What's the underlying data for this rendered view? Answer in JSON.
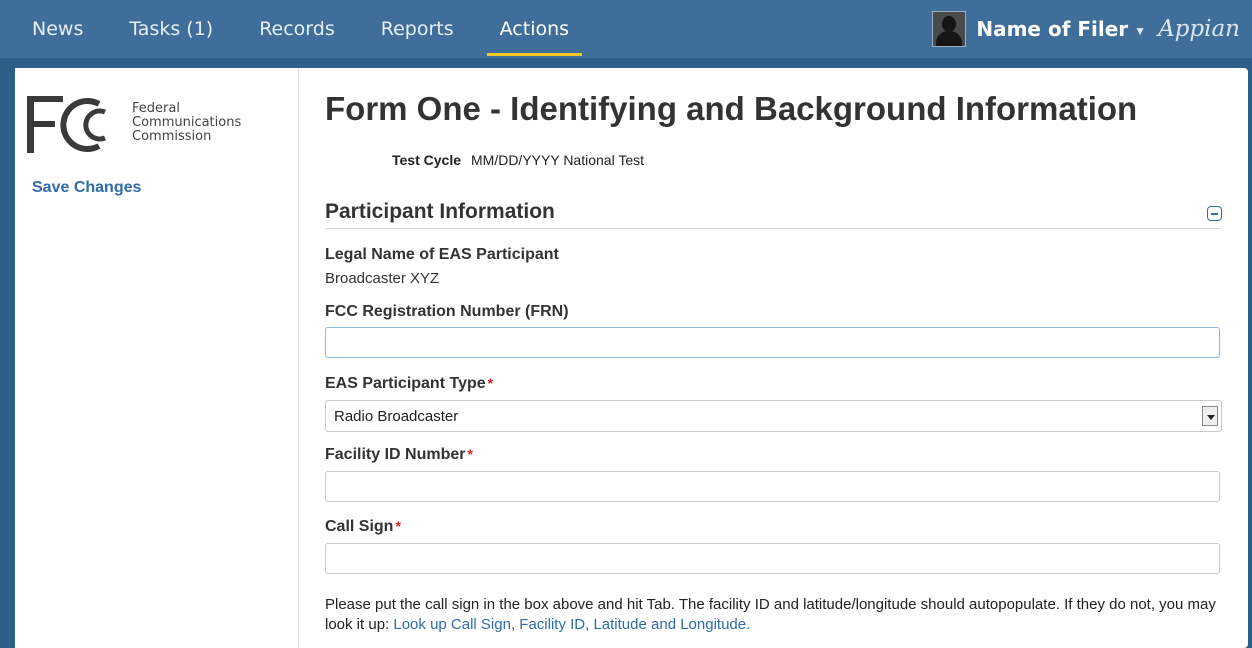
{
  "nav": {
    "items": [
      {
        "label": "News"
      },
      {
        "label": "Tasks (1)"
      },
      {
        "label": "Records"
      },
      {
        "label": "Reports"
      },
      {
        "label": "Actions"
      }
    ],
    "active": "Actions"
  },
  "user": {
    "name": "Name of Filer",
    "brand": "Appian"
  },
  "sidebar": {
    "logo_lines": [
      "Federal",
      "Communications",
      "Commission"
    ],
    "save_label": "Save Changes"
  },
  "form": {
    "title": "Form One - Identifying and Background Information",
    "cycle_label": "Test Cycle",
    "cycle_value": "MM/DD/YYYY National Test",
    "section_title": "Participant Information",
    "legal_name_label": "Legal Name of EAS Participant",
    "legal_name_value": "Broadcaster XYZ",
    "frn_label": "FCC Registration Number (FRN)",
    "frn_value": "",
    "type_label": "EAS Participant Type",
    "type_value": "Radio Broadcaster",
    "facility_label": "Facility ID Number",
    "facility_value": "",
    "callsign_label": "Call Sign",
    "callsign_value": "",
    "required_mark": "*",
    "help_text": "Please put the call sign in the box above and hit Tab. The facility ID and latitude/longitude should autopopulate. If they do not, you may look it up: ",
    "help_link": "Look up Call Sign, Facility ID, Latitude and Longitude."
  },
  "colors": {
    "topbar": "#3f6e9a",
    "accent": "#f3c726",
    "link": "#2f6ca8",
    "required": "#e02020"
  }
}
